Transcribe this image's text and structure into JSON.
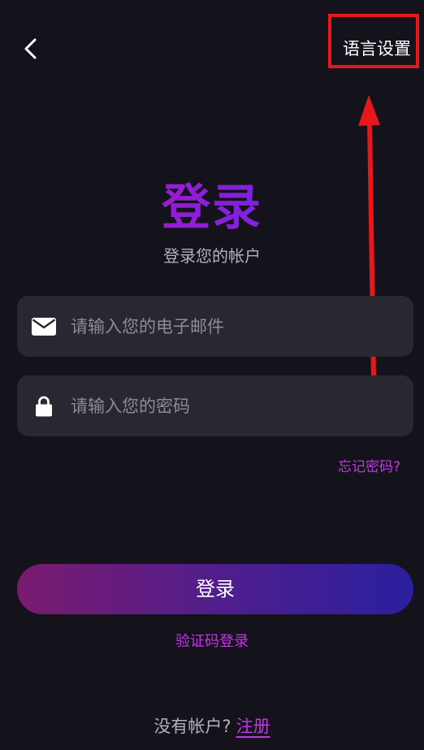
{
  "header": {
    "back_icon": "chevron-left-icon",
    "language_label": "语言设置"
  },
  "login": {
    "title": "登录",
    "subtitle": "登录您的帐户",
    "email_placeholder": "请输入您的电子邮件",
    "email_icon": "envelope-icon",
    "password_placeholder": "请输入您的密码",
    "password_icon": "lock-icon",
    "forgot_label": "忘记密码?",
    "submit_label": "登录",
    "code_login_label": "验证码登录"
  },
  "footer": {
    "no_account_label": "没有帐户?",
    "signup_label": "注册"
  },
  "annotation": {
    "highlight_color": "#e8171c"
  },
  "colors": {
    "background": "#14131c",
    "field_background": "#292831",
    "accent": "#c236e6",
    "title_gradient_start": "#c21ba8",
    "title_gradient_end": "#4d2ff0",
    "button_gradient_start": "#7a1b6f",
    "button_gradient_end": "#2a1f9e"
  }
}
